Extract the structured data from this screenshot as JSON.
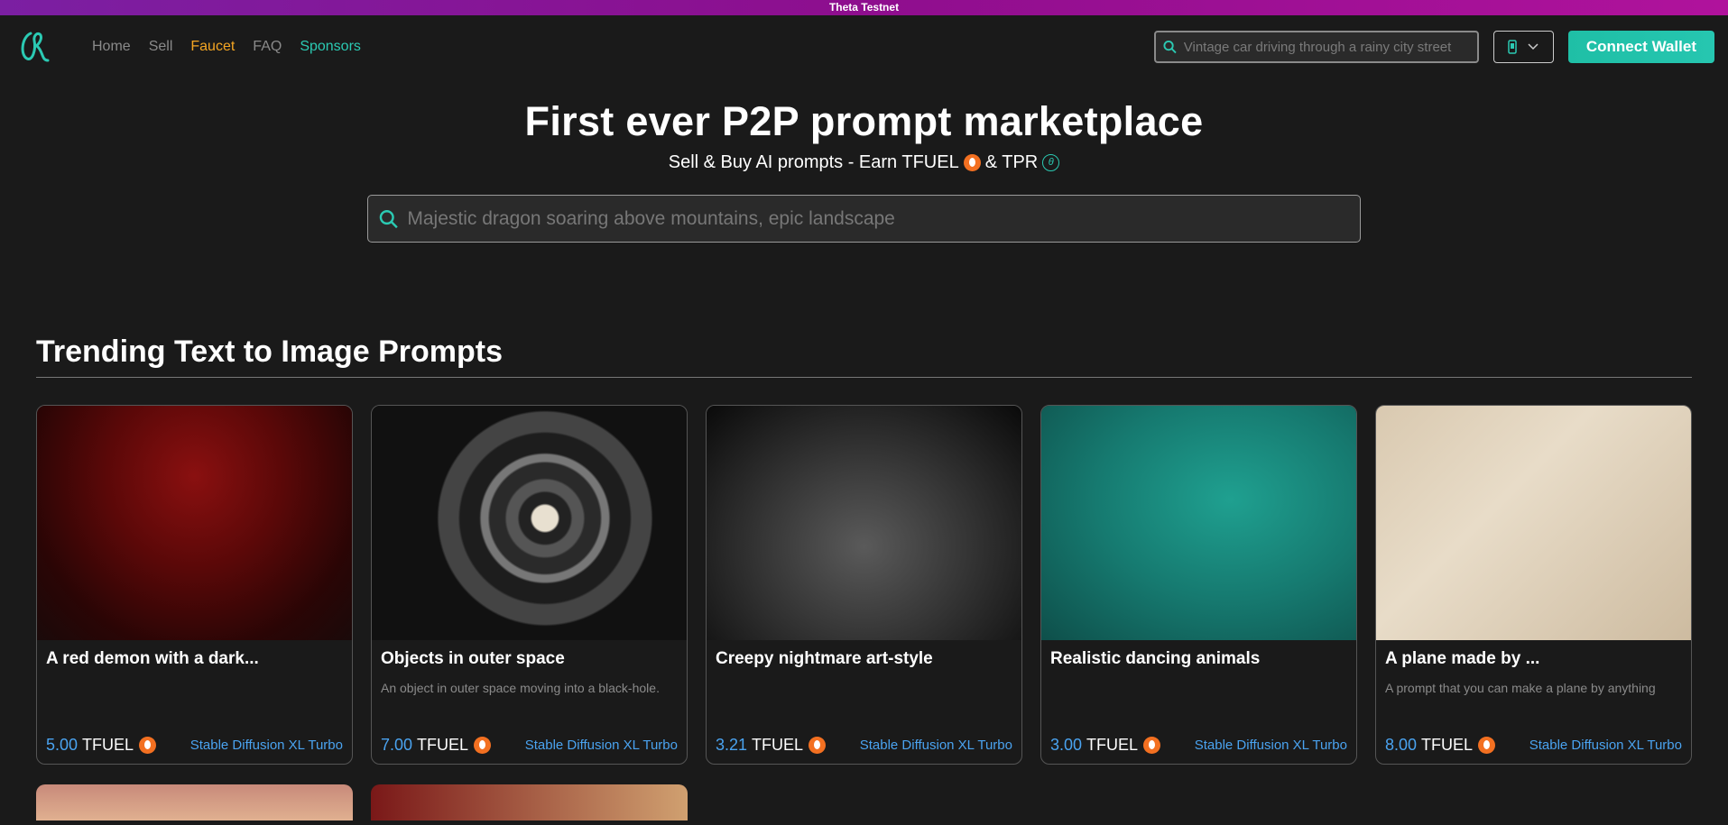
{
  "banner": "Theta Testnet",
  "nav": {
    "links": [
      "Home",
      "Sell",
      "Faucet",
      "FAQ",
      "Sponsors"
    ],
    "search_placeholder": "Vintage car driving through a rainy city street",
    "connect_label": "Connect Wallet"
  },
  "hero": {
    "title": "First ever P2P prompt marketplace",
    "sub_prefix": "Sell & Buy AI prompts - Earn TFUEL",
    "sub_mid": "& TPR",
    "search_placeholder": "Majestic dragon soaring above mountains, epic landscape"
  },
  "section": {
    "title": "Trending Text to Image Prompts"
  },
  "cards": [
    {
      "title": "A red demon with a dark...",
      "desc": "",
      "price": "5.00",
      "unit": "TFUEL",
      "model": "Stable Diffusion XL Turbo"
    },
    {
      "title": "Objects in outer space",
      "desc": "An object in outer space moving into a black-hole.",
      "price": "7.00",
      "unit": "TFUEL",
      "model": "Stable Diffusion XL Turbo"
    },
    {
      "title": "Creepy nightmare art-style",
      "desc": "",
      "price": "3.21",
      "unit": "TFUEL",
      "model": "Stable Diffusion XL Turbo"
    },
    {
      "title": "Realistic dancing animals",
      "desc": "",
      "price": "3.00",
      "unit": "TFUEL",
      "model": "Stable Diffusion XL Turbo"
    },
    {
      "title": "A plane made by ...",
      "desc": "A prompt that you can make a plane by anything",
      "price": "8.00",
      "unit": "TFUEL",
      "model": "Stable Diffusion XL Turbo"
    }
  ]
}
